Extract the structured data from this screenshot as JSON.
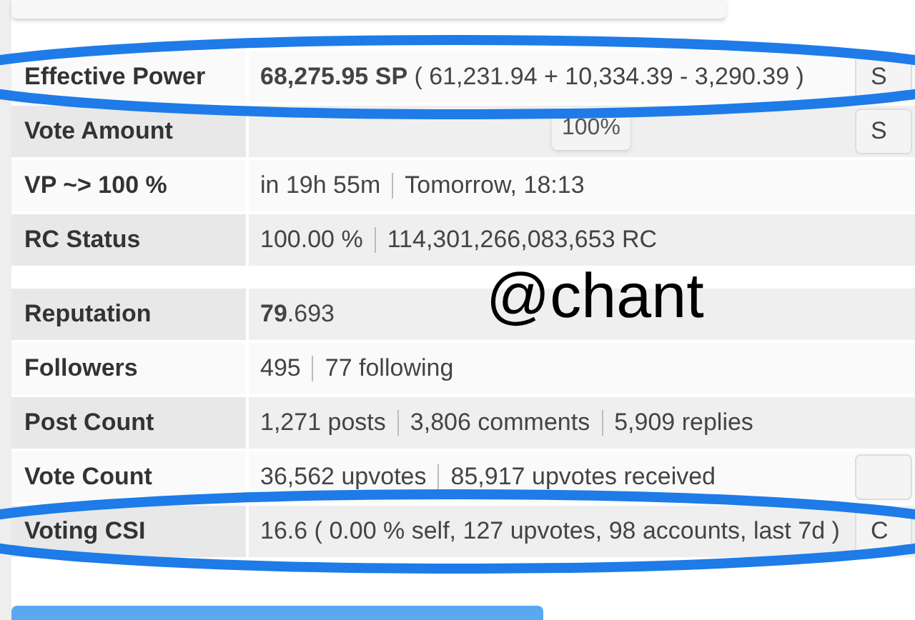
{
  "sections": [
    {
      "rows": [
        {
          "label": "Effective Power",
          "shaded": false,
          "parts": [
            "**68,275.95 SP** ( 61,231.94 + 10,334.39 - 3,290.39 )"
          ],
          "side_button": "S"
        },
        {
          "label": "Vote Amount",
          "shaded": true,
          "parts": [],
          "percent_button": "100%",
          "side_button": "S"
        },
        {
          "label": "VP ~> 100 %",
          "shaded": false,
          "parts": [
            "in 19h 55m",
            "Tomorrow, 18:13"
          ]
        },
        {
          "label": "RC Status",
          "shaded": true,
          "parts": [
            "100.00 %",
            "114,301,266,083,653 RC"
          ]
        }
      ]
    },
    {
      "rows": [
        {
          "label": "Reputation",
          "shaded": true,
          "parts": [
            "**79**.693"
          ]
        },
        {
          "label": "Followers",
          "shaded": false,
          "parts": [
            "495",
            "77 following"
          ]
        },
        {
          "label": "Post Count",
          "shaded": true,
          "parts": [
            "1,271 posts",
            "3,806 comments",
            "5,909 replies"
          ]
        },
        {
          "label": "Vote Count",
          "shaded": false,
          "parts": [
            "36,562 upvotes",
            "85,917 upvotes received"
          ],
          "side_button": ""
        },
        {
          "label": "Voting CSI",
          "shaded": true,
          "parts": [
            "16.6 ( 0.00 % self, 127 upvotes, 98 accounts, last 7d )"
          ],
          "side_button": "C"
        }
      ]
    }
  ],
  "annotation_text": "@chant"
}
